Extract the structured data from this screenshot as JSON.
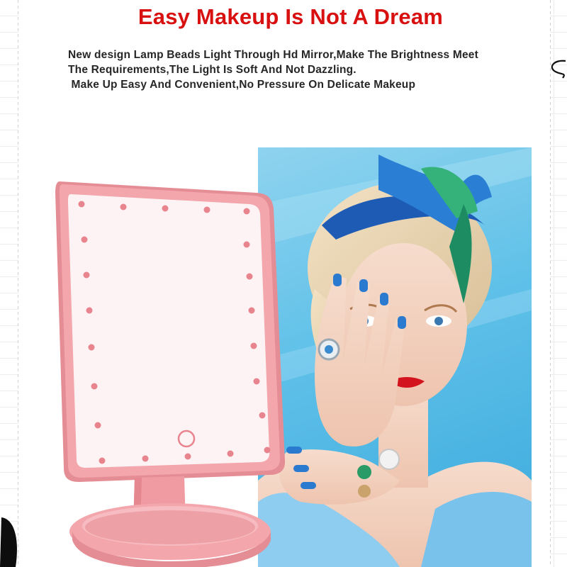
{
  "headline": "Easy Makeup Is Not A Dream",
  "description": {
    "line1": "New design Lamp Beads Light Through Hd Mirror,Make The Brightness Meet",
    "line2": "The Requirements,The Light Is Soft And Not Dazzling.",
    "line3": " Make Up Easy And Convenient,No Pressure On Delicate Makeup"
  },
  "colors": {
    "headline": "#d81010",
    "mirror_pink": "#f3a6ac",
    "photo_blue": "#5ec0e8"
  }
}
